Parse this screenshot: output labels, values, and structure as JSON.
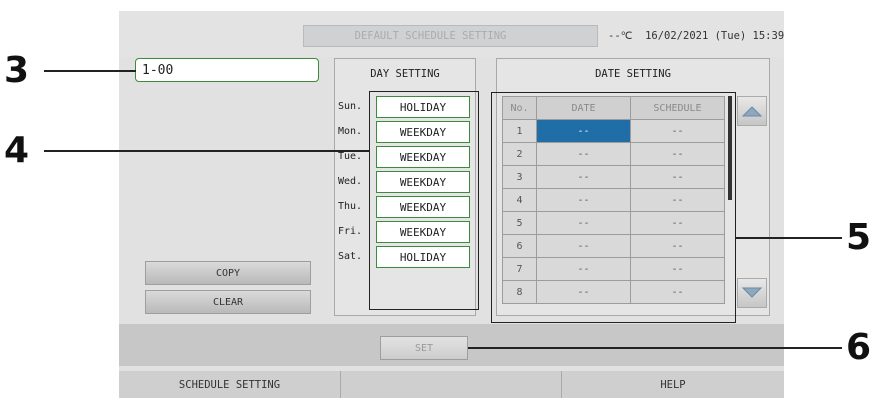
{
  "header": {
    "title": "DEFAULT SCHEDULE SETTING",
    "status": "--℃  16/02/2021 (Tue) 15:39"
  },
  "name_field": {
    "value": "1-00"
  },
  "day_setting": {
    "title": "DAY SETTING",
    "days": [
      {
        "day": "Sun.",
        "value": "HOLIDAY"
      },
      {
        "day": "Mon.",
        "value": "WEEKDAY"
      },
      {
        "day": "Tue.",
        "value": "WEEKDAY"
      },
      {
        "day": "Wed.",
        "value": "WEEKDAY"
      },
      {
        "day": "Thu.",
        "value": "WEEKDAY"
      },
      {
        "day": "Fri.",
        "value": "WEEKDAY"
      },
      {
        "day": "Sat.",
        "value": "HOLIDAY"
      }
    ]
  },
  "date_setting": {
    "title": "DATE SETTING",
    "columns": [
      "No.",
      "DATE",
      "SCHEDULE"
    ],
    "rows": [
      {
        "no": "1",
        "date": "--",
        "schedule": "--"
      },
      {
        "no": "2",
        "date": "--",
        "schedule": "--"
      },
      {
        "no": "3",
        "date": "--",
        "schedule": "--"
      },
      {
        "no": "4",
        "date": "--",
        "schedule": "--"
      },
      {
        "no": "5",
        "date": "--",
        "schedule": "--"
      },
      {
        "no": "6",
        "date": "--",
        "schedule": "--"
      },
      {
        "no": "7",
        "date": "--",
        "schedule": "--"
      },
      {
        "no": "8",
        "date": "--",
        "schedule": "--"
      }
    ],
    "selected_row": 1,
    "scroll_up_icon": "triangle-up-icon",
    "scroll_down_icon": "triangle-down-icon"
  },
  "buttons": {
    "copy": "COPY",
    "clear": "CLEAR",
    "set": "SET"
  },
  "tabs": [
    "SCHEDULE SETTING",
    "",
    "HELP"
  ],
  "callouts": [
    "3",
    "4",
    "5",
    "6"
  ],
  "colors": {
    "selected_cell": "#1f6ea8",
    "button_border": "#3c8a3c"
  }
}
